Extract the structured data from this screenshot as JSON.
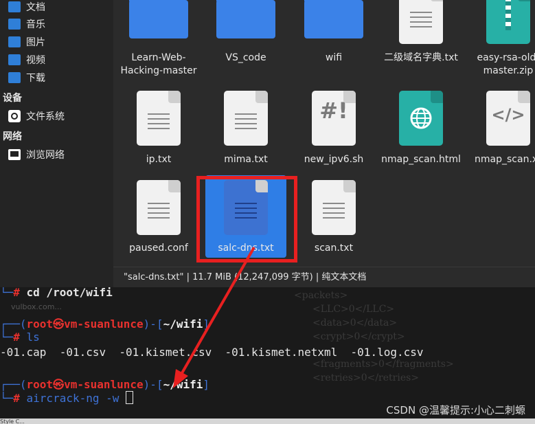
{
  "sidebar": {
    "items": [
      {
        "label": "文档",
        "icon": "documents-icon"
      },
      {
        "label": "音乐",
        "icon": "music-icon"
      },
      {
        "label": "图片",
        "icon": "pictures-icon"
      },
      {
        "label": "视频",
        "icon": "videos-icon"
      },
      {
        "label": "下载",
        "icon": "downloads-icon"
      }
    ],
    "devices_heading": "设备",
    "filesystem_label": "文件系统",
    "network_heading": "网络",
    "browse_network_label": "浏览网络"
  },
  "files": {
    "row1": [
      {
        "name": "Learn-Web-Hacking-master",
        "line1": "Learn-Web-",
        "line2": "Hacking-master",
        "type": "folder"
      },
      {
        "name": "VS_code",
        "type": "folder"
      },
      {
        "name": "wifi",
        "type": "folder"
      },
      {
        "name": "二级域名字典.txt",
        "type": "text"
      },
      {
        "name": "easy-rsa-old-master.zip",
        "line1": "easy-rsa-old-",
        "line2": "master.zip",
        "type": "archive"
      }
    ],
    "row2": [
      {
        "name": "ip.txt",
        "type": "text"
      },
      {
        "name": "mima.txt",
        "type": "text"
      },
      {
        "name": "new_ipv6.sh",
        "type": "script",
        "glyph": "#!"
      },
      {
        "name": "nmap_scan.html",
        "type": "html"
      },
      {
        "name": "nmap_scan.xml",
        "display": "nmap_scan.xr",
        "type": "xml",
        "glyph": "</>"
      }
    ],
    "row3": [
      {
        "name": "paused.conf",
        "type": "text"
      },
      {
        "name": "salc-dns.txt",
        "type": "text",
        "selected": true
      },
      {
        "name": "scan.txt",
        "type": "text"
      }
    ]
  },
  "statusbar": {
    "text": "\"salc-dns.txt\" | 11.7 MiB (12,247,099 字节) | 纯文本文档"
  },
  "terminal": {
    "line0_cmd": "cd /root/wifi",
    "user": "root",
    "skull": "㉿",
    "host": "vm-suanlunce",
    "dir": "~/wifi",
    "ls_cmd": "ls",
    "ls_output": "-01.cap  -01.csv  -01.kismet.csv  -01.kismet.netxml  -01.log.csv",
    "last_cmd": "aircrack-ng",
    "last_arg": "-w",
    "faint_text": "vulbox.com..."
  },
  "watermark": "CSDN @温馨提示:小心二刺螈",
  "bottom_hint": "Style C...",
  "colors": {
    "highlight": "#e82020",
    "selection": "#2f7ee6",
    "folder": "#3b82e8",
    "teal": "#27b0a6",
    "prompt_blue": "#3e72d6",
    "prompt_red": "#e8312e"
  }
}
